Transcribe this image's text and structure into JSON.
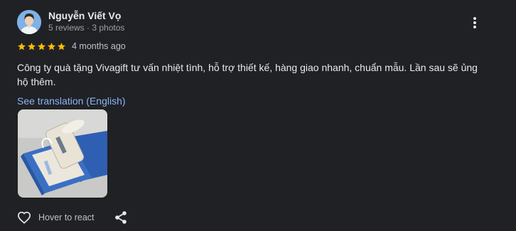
{
  "reviewer": {
    "name": "Nguyễn Viết Vọ",
    "meta": "5 reviews · 3 photos"
  },
  "rating": {
    "stars": 5,
    "max": 5,
    "time_ago": "4 months ago",
    "star_color": "#fbbc04"
  },
  "review": {
    "text": "Công ty quà tặng Vivagift tư vấn nhiệt tình, hỗ trợ thiết kế, hàng giao nhanh, chuẩn mẫu. Lần sau sẽ ủng hộ thêm.",
    "translate_label": "See translation (English)"
  },
  "actions": {
    "react_label": "Hover to react",
    "react_icon": "heart-icon",
    "share_icon": "share-icon",
    "more_icon": "more-vert-icon"
  },
  "colors": {
    "background": "#202124",
    "link": "#8ab4f8",
    "text": "#e8eaed",
    "secondary_text": "#9aa0a6"
  }
}
